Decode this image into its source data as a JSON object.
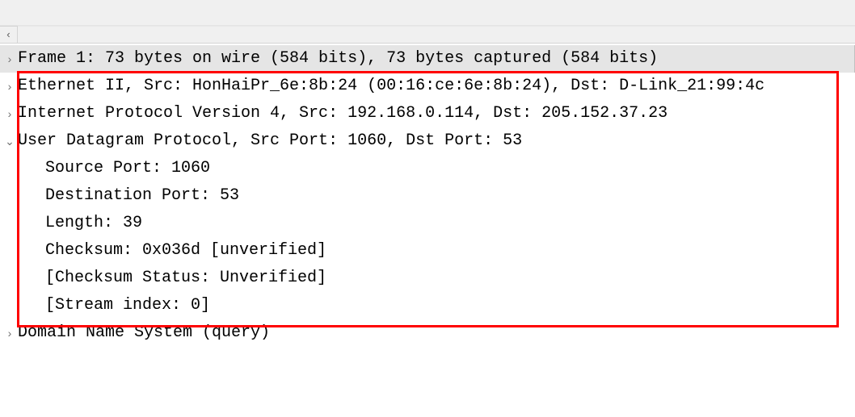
{
  "tree": {
    "frame": "Frame 1: 73 bytes on wire (584 bits), 73 bytes captured (584 bits)",
    "eth": "Ethernet II, Src: HonHaiPr_6e:8b:24 (00:16:ce:6e:8b:24), Dst: D-Link_21:99:4c",
    "ip": "Internet Protocol Version 4, Src: 192.168.0.114, Dst: 205.152.37.23",
    "udp": "User Datagram Protocol, Src Port: 1060, Dst Port: 53",
    "udp_children": {
      "src_port": "Source Port: 1060",
      "dst_port": "Destination Port: 53",
      "length": "Length: 39",
      "checksum": "Checksum: 0x036d [unverified]",
      "checksum_status": "[Checksum Status: Unverified]",
      "stream_index": "[Stream index: 0]"
    },
    "dns": "Domain Name System (query)"
  },
  "glyphs": {
    "collapsed": "›",
    "expanded": "⌄",
    "scroll_left": "‹"
  }
}
